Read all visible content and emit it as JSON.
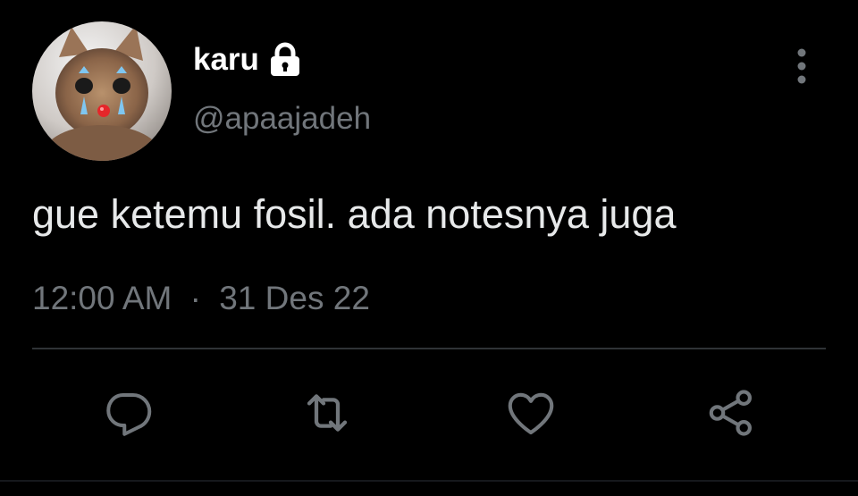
{
  "user": {
    "display_name": "karu",
    "handle": "@apaajadeh",
    "protected_icon": "lock-icon",
    "avatar_icon": "cat-avatar"
  },
  "tweet": {
    "text": "gue ketemu fosil. ada notesnya juga",
    "time": "12:00 AM",
    "separator": "·",
    "date": "31 Des 22"
  },
  "actions": {
    "reply_icon": "reply-icon",
    "retweet_icon": "retweet-icon",
    "like_icon": "heart-icon",
    "share_icon": "share-icon",
    "more_icon": "more-vertical-icon"
  },
  "colors": {
    "background": "#000000",
    "text_primary": "#e7e9ea",
    "text_secondary": "#71767b",
    "divider": "#2f3336"
  }
}
